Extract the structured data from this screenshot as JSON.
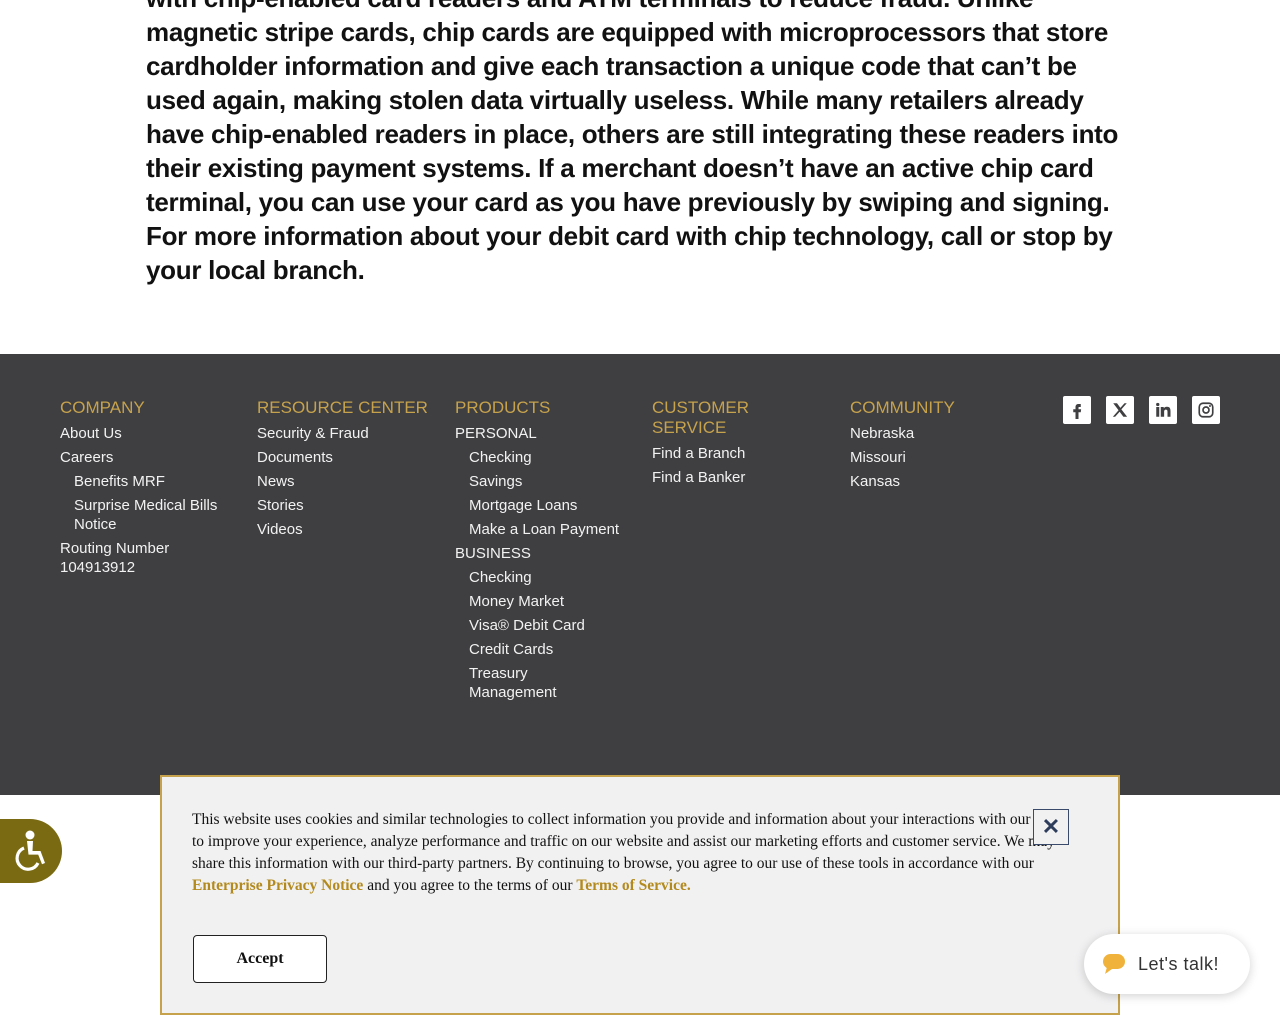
{
  "main": {
    "paragraph": "with chip-enabled card readers and ATM terminals to reduce fraud. Unlike magnetic stripe cards, chip cards are equipped with microprocessors that store cardholder information and give each transaction a unique code that can’t be used again, making stolen data virtually useless. While many retailers already have chip-enabled readers in place, others are still integrating these readers into their existing payment systems. If a merchant doesn’t have an active chip card terminal, you can use your card as you have previously by swiping and signing. For more information about your debit card with chip technology, call or stop by your local branch."
  },
  "footer": {
    "company": {
      "heading": "COMPANY",
      "about": "About Us",
      "careers": "Careers",
      "benefits": "Benefits MRF",
      "surprise": "Surprise Medical Bills Notice",
      "routing": "Routing Number 104913912"
    },
    "resource": {
      "heading": "RESOURCE CENTER",
      "items": [
        "Security & Fraud",
        "Documents",
        "News",
        "Stories",
        "Videos"
      ]
    },
    "products": {
      "heading": "PRODUCTS",
      "personal": "PERSONAL",
      "personal_items": [
        "Checking",
        "Savings",
        "Mortgage Loans",
        "Make a Loan Payment"
      ],
      "business": "BUSINESS",
      "business_items": [
        "Checking",
        "Money Market",
        "Visa® Debit Card",
        "Credit Cards",
        "Treasury Management"
      ]
    },
    "customer": {
      "heading": "CUSTOMER SERVICE",
      "items": [
        "Find a Branch",
        "Find a Banker"
      ]
    },
    "community": {
      "heading": "COMMUNITY",
      "items": [
        "Nebraska",
        "Missouri",
        "Kansas"
      ]
    },
    "social": [
      "facebook-icon",
      "x-twitter-icon",
      "linkedin-icon",
      "instagram-icon"
    ]
  },
  "cookie": {
    "text_before": "This website uses cookies and similar technologies to collect information you provide and information about your interactions with our sites to improve your experience, analyze performance and traffic on our website and assist our marketing efforts and customer service. We may share this information with our third-party partners. By continuing to browse, you agree to our use of these tools in accordance with our ",
    "privacy_link": "Enterprise Privacy Notice",
    "text_middle": " and you agree to the terms of our ",
    "terms_link": "Terms of Service.",
    "close": "✕",
    "accept": "Accept"
  },
  "chat": {
    "label": "Let's talk!"
  },
  "colors": {
    "accent": "#c6a24c",
    "footer_bg": "#3f3f42",
    "access_bg": "#7a6a12"
  }
}
